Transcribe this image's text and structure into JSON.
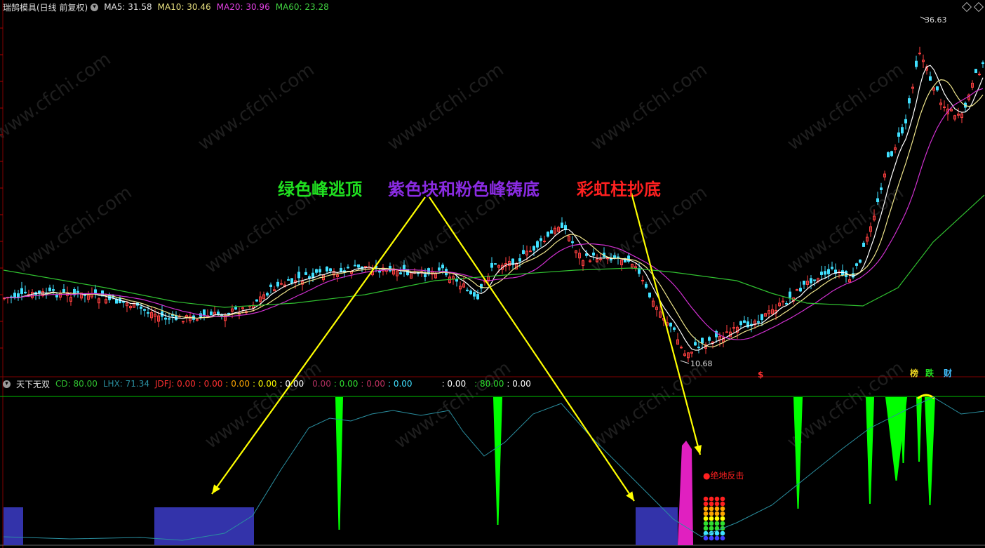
{
  "main_header": {
    "title": "瑞鹄模具(日线 前复权)",
    "ma5": "MA5: 31.58",
    "ma10": "MA10: 30.46",
    "ma20": "MA20: 30.96",
    "ma60": "MA60: 23.28"
  },
  "indicator_header": {
    "title": "天下无双",
    "cd": "CD: 80.00",
    "lhx": "LHX: 71.34",
    "jdfj": "JDFJ: 0.00",
    "values": [
      ": 0.00",
      ": 0.00",
      ": 0.00",
      ": 0.00",
      "0.00",
      ": 0.00",
      ": 0.00",
      ": 0.00",
      ": 0.00",
      ": 80.00",
      ": 0.00"
    ]
  },
  "price_labels": {
    "high": "36.63",
    "low": "10.68"
  },
  "annotations": {
    "green": "绿色峰逃顶",
    "purple": "紫色块和粉色峰铸底",
    "red": "彩虹柱抄底",
    "signal": "●绝地反击"
  },
  "tags": [
    "榜",
    "跌",
    "财"
  ],
  "dollar_marker": "$",
  "watermark": "www.cfchi.com",
  "colors": {
    "ma5": "#ffffff",
    "ma10": "#f0e68c",
    "ma20": "#d030d0",
    "ma60": "#30c030",
    "up": "#ff4040",
    "down": "#40e0ff",
    "green_peak": "#00ff00",
    "purple_block": "#3333aa",
    "pink_peak": "#e020c0",
    "arrow": "#ffff00",
    "lhx": "#2a8fa0"
  }
}
